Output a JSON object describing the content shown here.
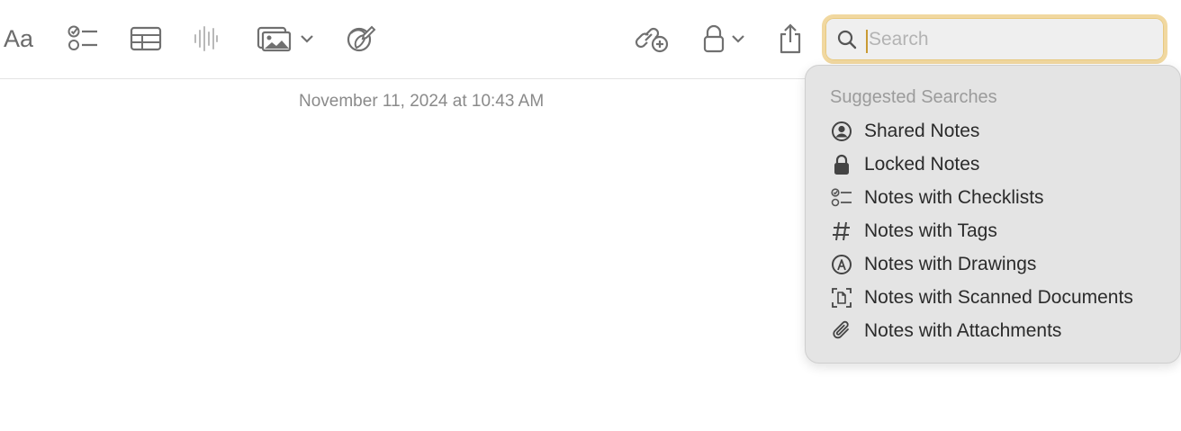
{
  "toolbar": {
    "format_label": "Aa",
    "buttons": [
      {
        "name": "format-button",
        "icon": "text-format-icon"
      },
      {
        "name": "checklist-button",
        "icon": "checklist-icon"
      },
      {
        "name": "table-button",
        "icon": "table-icon"
      },
      {
        "name": "audio-button",
        "icon": "waveform-icon"
      },
      {
        "name": "media-button",
        "icon": "photo-icon"
      },
      {
        "name": "markup-button",
        "icon": "markup-icon"
      },
      {
        "name": "collaborate-button",
        "icon": "add-link-icon"
      },
      {
        "name": "lock-button",
        "icon": "lock-icon"
      },
      {
        "name": "share-button",
        "icon": "share-icon"
      }
    ]
  },
  "note": {
    "date": "November 11, 2024 at 10:43 AM"
  },
  "search": {
    "placeholder": "Search",
    "value": ""
  },
  "suggestions": {
    "title": "Suggested Searches",
    "items": [
      {
        "label": "Shared Notes",
        "icon": "person-circle-icon"
      },
      {
        "label": "Locked Notes",
        "icon": "lock-icon"
      },
      {
        "label": "Notes with Checklists",
        "icon": "checklist-icon"
      },
      {
        "label": "Notes with Tags",
        "icon": "hashtag-icon"
      },
      {
        "label": "Notes with Drawings",
        "icon": "pencil-tip-icon"
      },
      {
        "label": "Notes with Scanned Documents",
        "icon": "scanned-document-icon"
      },
      {
        "label": "Notes with Attachments",
        "icon": "paperclip-icon"
      }
    ]
  },
  "colors": {
    "search_focus_ring": "#f1d8a0",
    "caret": "#c99a33",
    "dropdown_bg": "#e4e4e4"
  }
}
